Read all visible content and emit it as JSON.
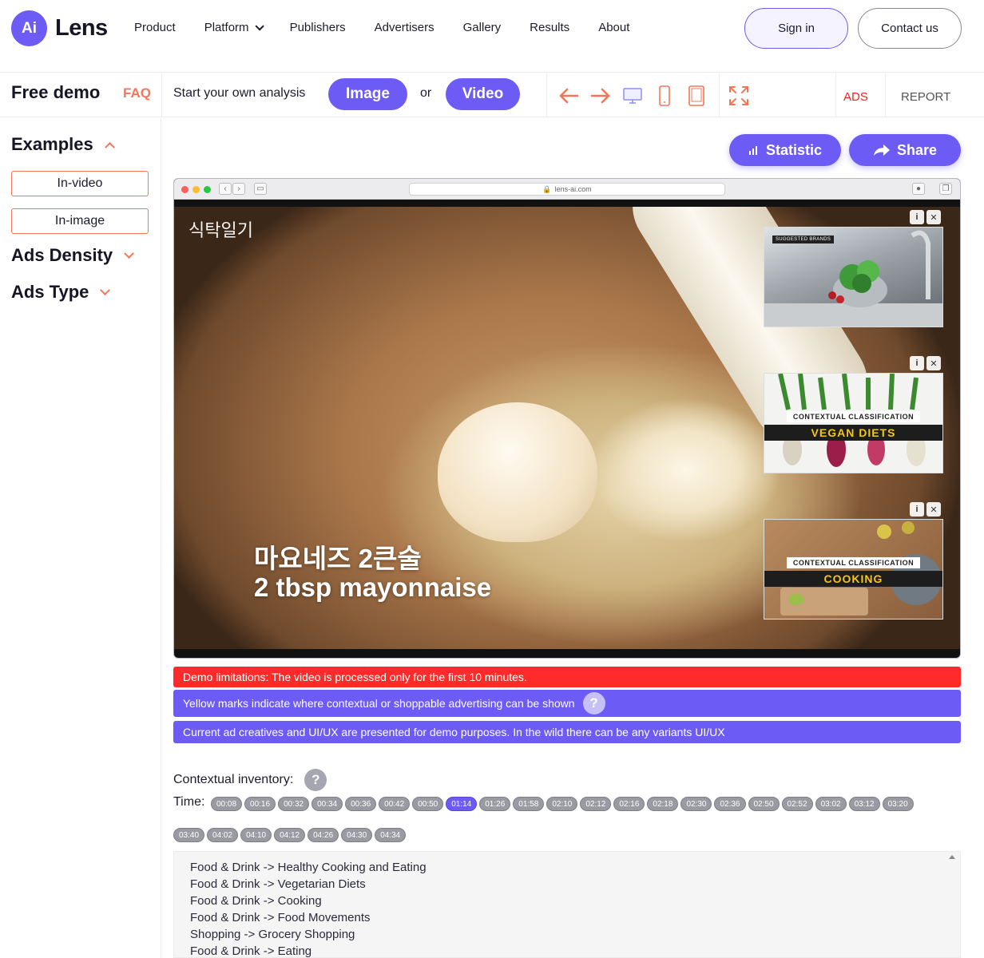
{
  "brand": {
    "badge": "Ai",
    "name": "Lens",
    "accent": "#6c5cf5",
    "secondary": "#f2775a"
  },
  "nav": {
    "items": [
      "Product",
      "Platform",
      "Publishers",
      "Advertisers",
      "Gallery",
      "Results",
      "About"
    ],
    "sign_in": "Sign in",
    "contact": "Contact us"
  },
  "subbar": {
    "free_demo": "Free demo",
    "faq": "FAQ",
    "start_text": "Start your own analysis",
    "image_btn": "Image",
    "or": "or",
    "video_btn": "Video",
    "tools": [
      "arrow-left-icon",
      "arrow-right-icon",
      "desktop-icon",
      "phone-icon",
      "tablet-icon",
      "fullscreen-icon"
    ],
    "tab_ads": "ADS",
    "tab_report": "REPORT"
  },
  "sidebar": {
    "examples": "Examples",
    "in_video": "In-video",
    "in_image": "In-image",
    "ads_density": "Ads Density",
    "ads_type": "Ads Type"
  },
  "actions": {
    "statistic": "Statistic",
    "share": "Share"
  },
  "browser": {
    "url": "lens-ai.com",
    "video_tag": "식탁일기",
    "subtitle_ko": "마요네즈 2큰술",
    "subtitle_en": "2 tbsp mayonnaise",
    "ads": [
      {
        "label": "SUGGESTED BRANDS"
      },
      {
        "line1": "CONTEXTUAL CLASSIFICATION",
        "line2": "VEGAN DIETS"
      },
      {
        "line1": "CONTEXTUAL CLASSIFICATION",
        "line2": "COOKING"
      }
    ]
  },
  "notices": {
    "limit": "Demo limitations: The video is processed only for the first 10 minutes.",
    "yellow": "Yellow marks indicate where contextual or shoppable advertising can be shown",
    "creatives": "Current ad creatives and UI/UX are presented for demo purposes. In the wild there can be any variants UI/UX",
    "help": "?"
  },
  "inventory": {
    "title": "Contextual inventory:",
    "time_label": "Time:",
    "active_time": "01:14",
    "times_row1": [
      "00:08",
      "00:16",
      "00:32",
      "00:34",
      "00:36",
      "00:42",
      "00:50",
      "01:14",
      "01:26",
      "01:58",
      "02:10",
      "02:12",
      "02:16",
      "02:18",
      "02:30",
      "02:36",
      "02:50",
      "02:52",
      "03:02",
      "03:12",
      "03:20"
    ],
    "times_row2": [
      "03:40",
      "04:02",
      "04:10",
      "04:12",
      "04:26",
      "04:30",
      "04:34"
    ],
    "lines": [
      "Food & Drink -> Healthy Cooking and Eating",
      "Food & Drink -> Vegetarian Diets",
      "Food & Drink -> Cooking",
      "Food & Drink -> Food Movements",
      "Shopping -> Grocery Shopping",
      "Food & Drink -> Eating"
    ]
  }
}
